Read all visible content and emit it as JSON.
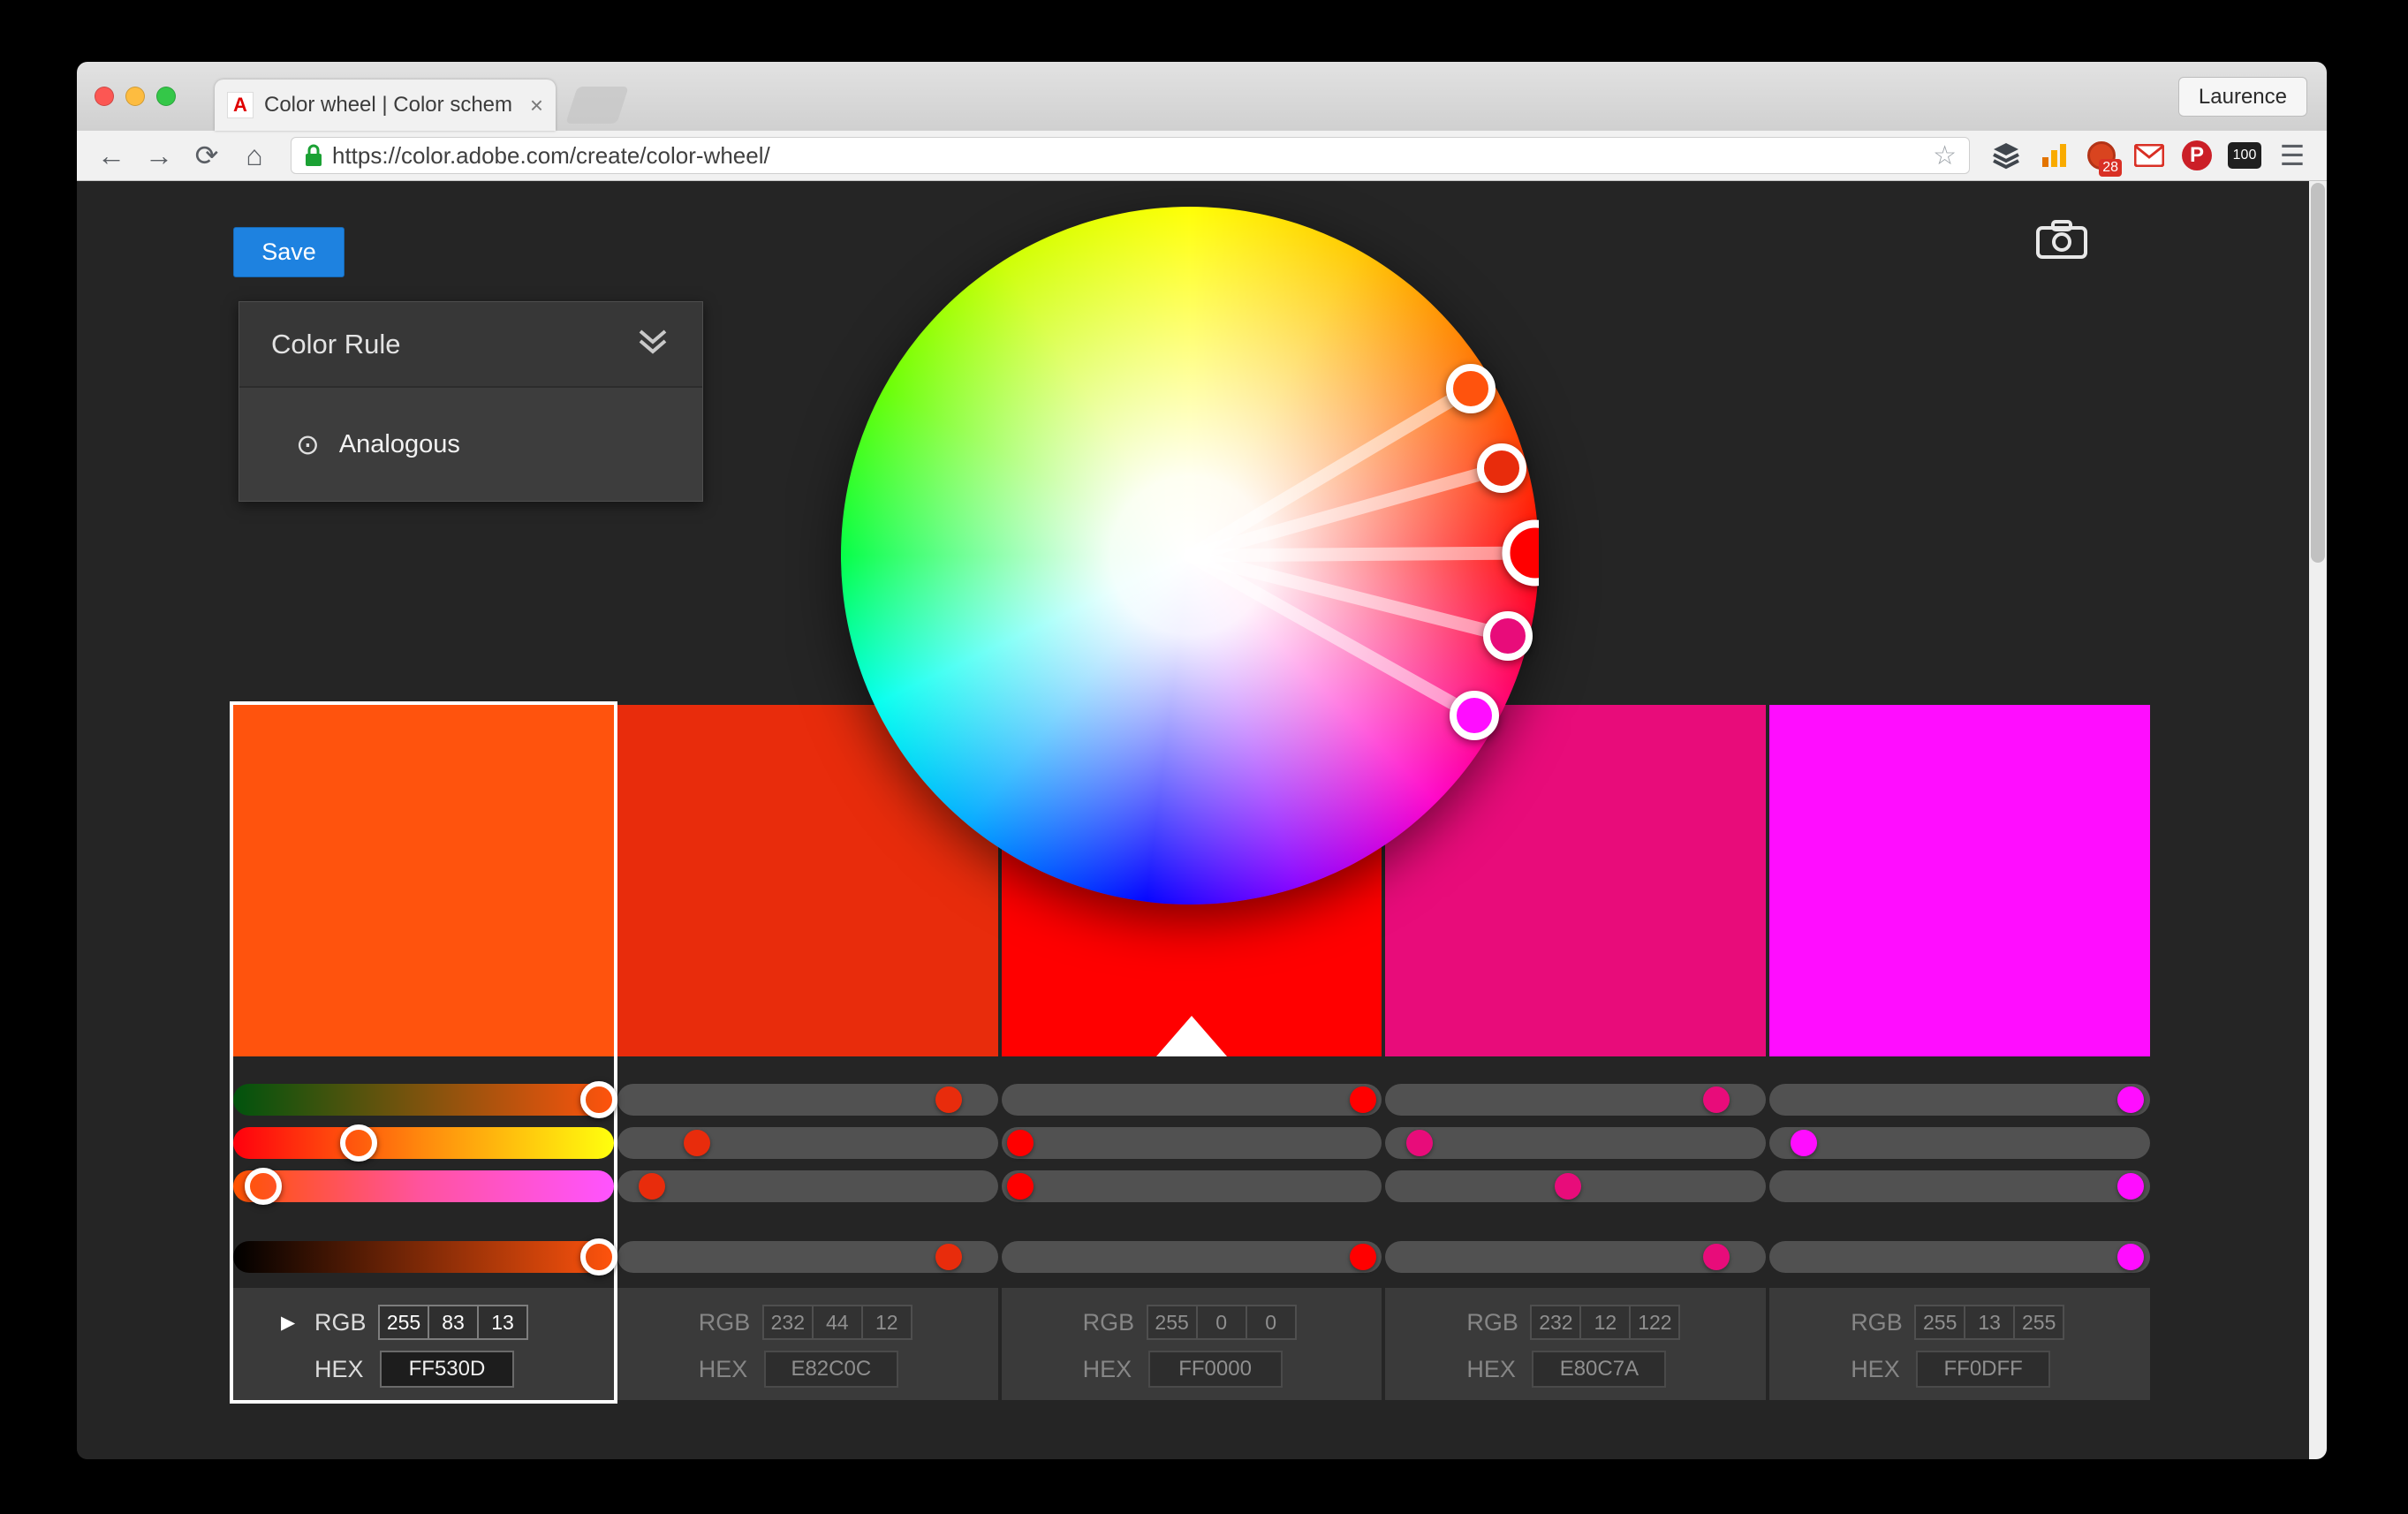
{
  "browser": {
    "tab_title": "Color wheel | Color schem",
    "favicon_letter": "A",
    "profile_name": "Laurence",
    "url": "https://color.adobe.com/create/color-wheel/",
    "extensions": {
      "tab_badge": "28",
      "pinterest_letter": "P",
      "hundred_label": "100"
    }
  },
  "icons": {
    "back": "←",
    "forward": "→",
    "reload": "⟳",
    "home": "⌂",
    "star": "☆",
    "menu": "☰",
    "tab_close": "×",
    "disclosure": "▶",
    "analogous_marker": "⊙"
  },
  "page": {
    "save_label": "Save",
    "color_rule_header": "Color Rule",
    "color_rule_selected": "Analogous",
    "rgb_label": "RGB",
    "hex_label": "HEX"
  },
  "swatches": [
    {
      "color": "#FF530D",
      "r": "255",
      "g": "83",
      "b": "13",
      "hex": "FF530D",
      "selected": true
    },
    {
      "color": "#E82C0C",
      "r": "232",
      "g": "44",
      "b": "12",
      "hex": "E82C0C",
      "selected": false
    },
    {
      "color": "#FF0000",
      "r": "255",
      "g": "0",
      "b": "0",
      "hex": "FF0000",
      "selected": false
    },
    {
      "color": "#E80C7A",
      "r": "232",
      "g": "12",
      "b": "122",
      "hex": "E80C7A",
      "selected": false
    },
    {
      "color": "#FF0DFF",
      "r": "255",
      "g": "13",
      "b": "255",
      "hex": "FF0DFF",
      "selected": false
    }
  ],
  "ui_colors": {
    "save_button": "#1E82E0",
    "content_background": "#252525",
    "selection_outline": "#FFFFFF"
  }
}
